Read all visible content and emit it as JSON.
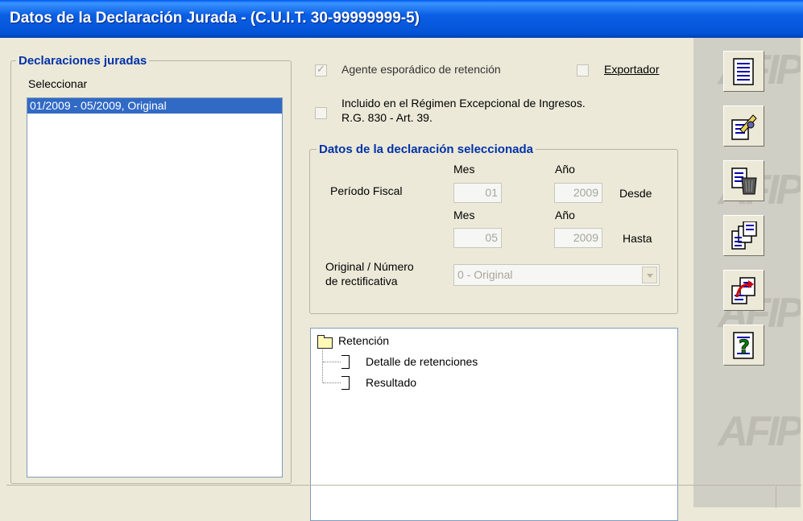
{
  "window": {
    "title": "Datos de la Declaración Jurada - (C.U.I.T. 30-99999999-5)"
  },
  "declaraciones": {
    "legend": "Declaraciones juradas",
    "select_label": "Seleccionar",
    "items": [
      {
        "label": "01/2009 - 05/2009, Original",
        "selected": true
      }
    ]
  },
  "options": {
    "agente": {
      "label": "Agente esporádico de retención",
      "checked": true,
      "enabled": false
    },
    "exportador": {
      "label": "Exportador",
      "checked": false
    },
    "incluido": {
      "label_line1": "Incluido en el Régimen Excepcional de Ingresos.",
      "label_line2": "R.G. 830 - Art. 39.",
      "checked": false
    }
  },
  "datos": {
    "legend": "Datos de la declaración seleccionada",
    "periodo_label": "Período Fiscal",
    "mes_label": "Mes",
    "anio_label": "Año",
    "desde": {
      "mes": "01",
      "anio": "2009",
      "label": "Desde"
    },
    "hasta": {
      "mes": "05",
      "anio": "2009",
      "label": "Hasta"
    },
    "original_label_line1": "Original / Número",
    "original_label_line2": "de rectificativa",
    "original_value": "0 - Original"
  },
  "tree": {
    "root": "Retención",
    "children": [
      "Detalle de retenciones",
      "Resultado"
    ]
  },
  "toolbar": {
    "buttons": [
      "list-doc-icon",
      "edit-doc-icon",
      "delete-doc-icon",
      "copy-doc-icon",
      "export-doc-icon",
      "help-doc-icon"
    ]
  },
  "branding": {
    "watermark": "AFIP"
  },
  "colors": {
    "title_blue": "#0453d6",
    "legend_blue": "#0032a8",
    "selection": "#316ac5"
  }
}
